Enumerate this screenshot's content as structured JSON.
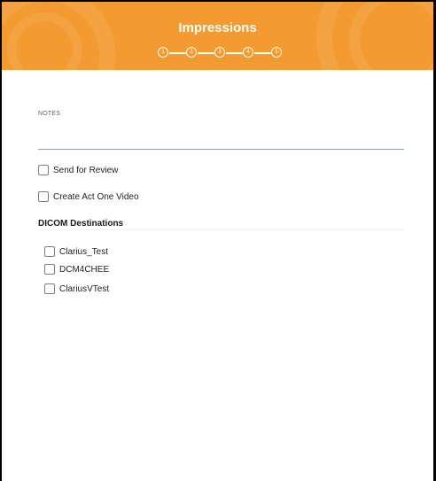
{
  "header": {
    "title": "Impressions",
    "steps": [
      "1",
      "2",
      "3",
      "4",
      "5"
    ],
    "colors": {
      "background": "#f39a30",
      "foreground": "#ffffff"
    }
  },
  "form": {
    "notes_label": "NOTES",
    "notes_value": "",
    "options": [
      {
        "label": "Send for Review",
        "checked": false
      },
      {
        "label": "Create Act One Video",
        "checked": false
      }
    ],
    "dicom": {
      "title": "DICOM Destinations",
      "destinations": [
        {
          "label": "Clarius_Test",
          "checked": false
        },
        {
          "label": "DCM4CHEE",
          "checked": false
        },
        {
          "label": "ClariusVTest",
          "checked": false
        }
      ]
    }
  }
}
